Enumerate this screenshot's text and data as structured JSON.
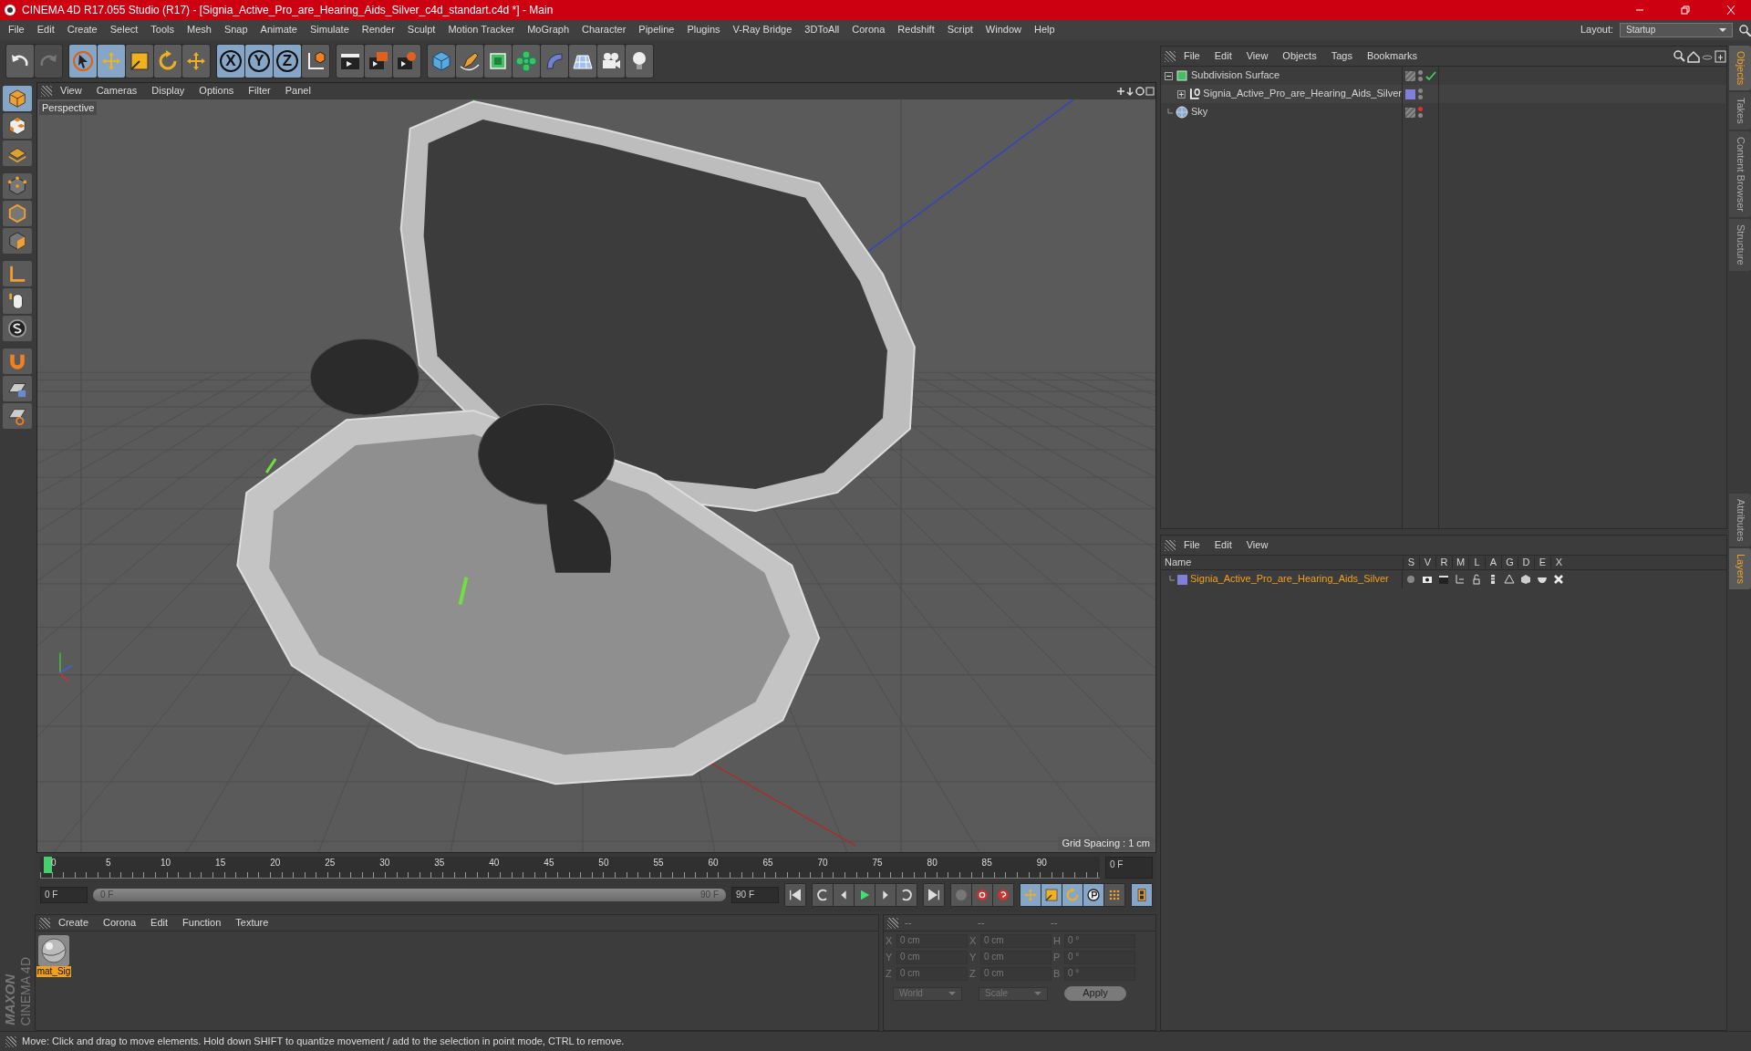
{
  "window": {
    "title": "CINEMA 4D R17.055 Studio (R17) - [Signia_Active_Pro_are_Hearing_Aids_Silver_c4d_standart.c4d *] - Main"
  },
  "menu": [
    "File",
    "Edit",
    "Create",
    "Select",
    "Tools",
    "Mesh",
    "Snap",
    "Animate",
    "Simulate",
    "Render",
    "Sculpt",
    "Motion Tracker",
    "MoGraph",
    "Character",
    "Pipeline",
    "Plugins",
    "V-Ray Bridge",
    "3DToAll",
    "Corona",
    "Redshift",
    "Script",
    "Window",
    "Help"
  ],
  "layout": {
    "label": "Layout:",
    "value": "Startup"
  },
  "toolbar": {
    "axis_buttons": [
      "X",
      "Y",
      "Z"
    ]
  },
  "viewport": {
    "menu": [
      "View",
      "Cameras",
      "Display",
      "Options",
      "Filter",
      "Panel"
    ],
    "camera": "Perspective",
    "grid_spacing": "Grid Spacing : 1 cm"
  },
  "timeline": {
    "ticks": [
      "0",
      "5",
      "10",
      "15",
      "20",
      "25",
      "30",
      "35",
      "40",
      "45",
      "50",
      "55",
      "60",
      "65",
      "70",
      "75",
      "80",
      "85",
      "90"
    ],
    "playhead": {
      "level": 0
    },
    "current_frame": "0 F",
    "start_field": "0 F",
    "range_start": "0 F",
    "range_end": "90 F",
    "range": {
      "level": 1
    },
    "end_field": "90 F"
  },
  "material_panel": {
    "menu": [
      "Create",
      "Corona",
      "Edit",
      "Function",
      "Texture"
    ],
    "materials": [
      {
        "name": "mat_Sig",
        "selected": true
      }
    ]
  },
  "coordinates": {
    "headers": [
      "--",
      "--",
      "--"
    ],
    "rows": [
      {
        "pos_label": "X",
        "pos": "0 cm",
        "size_label": "X",
        "size": "0 cm",
        "rot_label": "H",
        "rot": "0 °"
      },
      {
        "pos_label": "Y",
        "pos": "0 cm",
        "size_label": "Y",
        "size": "0 cm",
        "rot_label": "P",
        "rot": "0 °"
      },
      {
        "pos_label": "Z",
        "pos": "0 cm",
        "size_label": "Z",
        "size": "0 cm",
        "rot_label": "B",
        "rot": "0 °"
      }
    ],
    "space": "World",
    "mode": "Scale",
    "apply": "Apply"
  },
  "object_manager": {
    "menu": [
      "File",
      "Edit",
      "View",
      "Objects",
      "Tags",
      "Bookmarks"
    ],
    "objects": [
      {
        "name": "Subdivision Surface",
        "kind": "subdivision",
        "expanded": true,
        "enabled": true,
        "editor_visible": true,
        "children": [
          {
            "name": "Signia_Active_Pro_are_Hearing_Aids_Silver",
            "kind": "null",
            "expanded": false,
            "color": "#8080d8",
            "editor_visible": true
          }
        ]
      },
      {
        "name": "Sky",
        "kind": "sky",
        "editor_visible": false
      }
    ]
  },
  "layer_manager": {
    "menu": [
      "File",
      "Edit",
      "View"
    ],
    "columns": [
      "Name",
      "S",
      "V",
      "R",
      "M",
      "L",
      "A",
      "G",
      "D",
      "E",
      "X"
    ],
    "layers": [
      {
        "name": "Signia_Active_Pro_are_Hearing_Aids_Silver",
        "color": "#8080d8"
      }
    ]
  },
  "side_tabs": [
    {
      "label": "Objects",
      "selected": true
    },
    {
      "label": "Takes",
      "selected": false
    },
    {
      "label": "Content Browser",
      "selected": false
    },
    {
      "label": "Structure",
      "selected": false
    }
  ],
  "side_tabs_lower": [
    {
      "label": "Attributes",
      "selected": false
    },
    {
      "label": "Layers",
      "selected": true
    }
  ],
  "logo": {
    "brand": "MAXON",
    "product": "CINEMA 4D"
  },
  "status_bar": "Move: Click and drag to move elements. Hold down SHIFT to quantize movement / add to the selection in point mode, CTRL to remove."
}
